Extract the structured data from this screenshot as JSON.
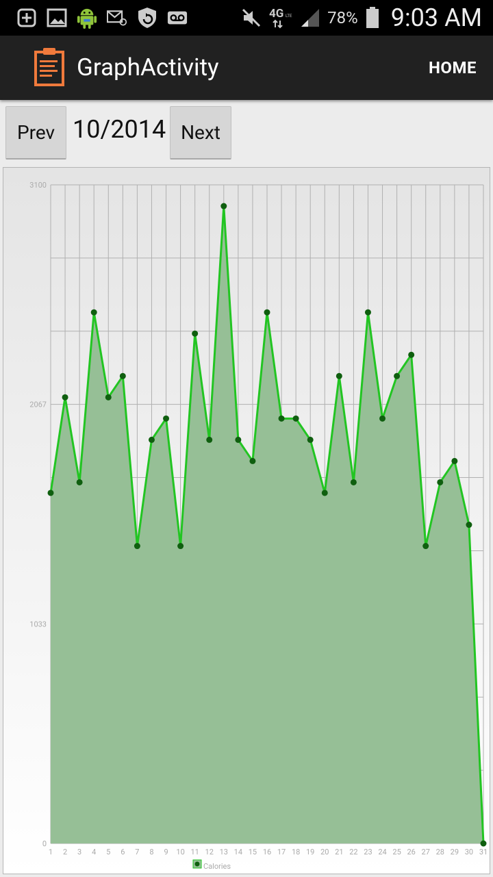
{
  "status_bar": {
    "icons": [
      "add-icon",
      "image-icon",
      "android-icon",
      "email-icon",
      "shield-icon",
      "voicemail-icon"
    ],
    "right_icons": [
      "mute-icon",
      "4g-lte-icon",
      "signal-icon",
      "battery-icon"
    ],
    "battery": "78%",
    "time": "9:03 AM"
  },
  "action_bar": {
    "title": "GraphActivity",
    "home_label": "HOME",
    "accent": "#f07a3c"
  },
  "controls": {
    "prev_label": "Prev",
    "period": "10/2014",
    "next_label": "Next"
  },
  "chart_data": {
    "type": "area",
    "x": [
      1,
      2,
      3,
      4,
      5,
      6,
      7,
      8,
      9,
      10,
      11,
      12,
      13,
      14,
      15,
      16,
      17,
      18,
      19,
      20,
      21,
      22,
      23,
      24,
      25,
      26,
      27,
      28,
      29,
      30,
      31
    ],
    "series": [
      {
        "name": "Calories",
        "values": [
          1650,
          2100,
          1700,
          2500,
          2100,
          2200,
          1400,
          1900,
          2000,
          1400,
          2400,
          1900,
          3000,
          1900,
          1800,
          2500,
          2000,
          2000,
          1900,
          1650,
          2200,
          1700,
          2500,
          2000,
          2200,
          2300,
          1400,
          1700,
          1800,
          1500,
          0
        ]
      }
    ],
    "y_ticks": [
      "0",
      "1033",
      "2067",
      "3100"
    ],
    "ylim": [
      0,
      3100
    ],
    "grid": true,
    "legend": "bottom-center",
    "colors": {
      "line": "#22c522",
      "fill": "#96bf96",
      "point": "#0f5f0f",
      "grid": "#b0b0b0"
    }
  }
}
